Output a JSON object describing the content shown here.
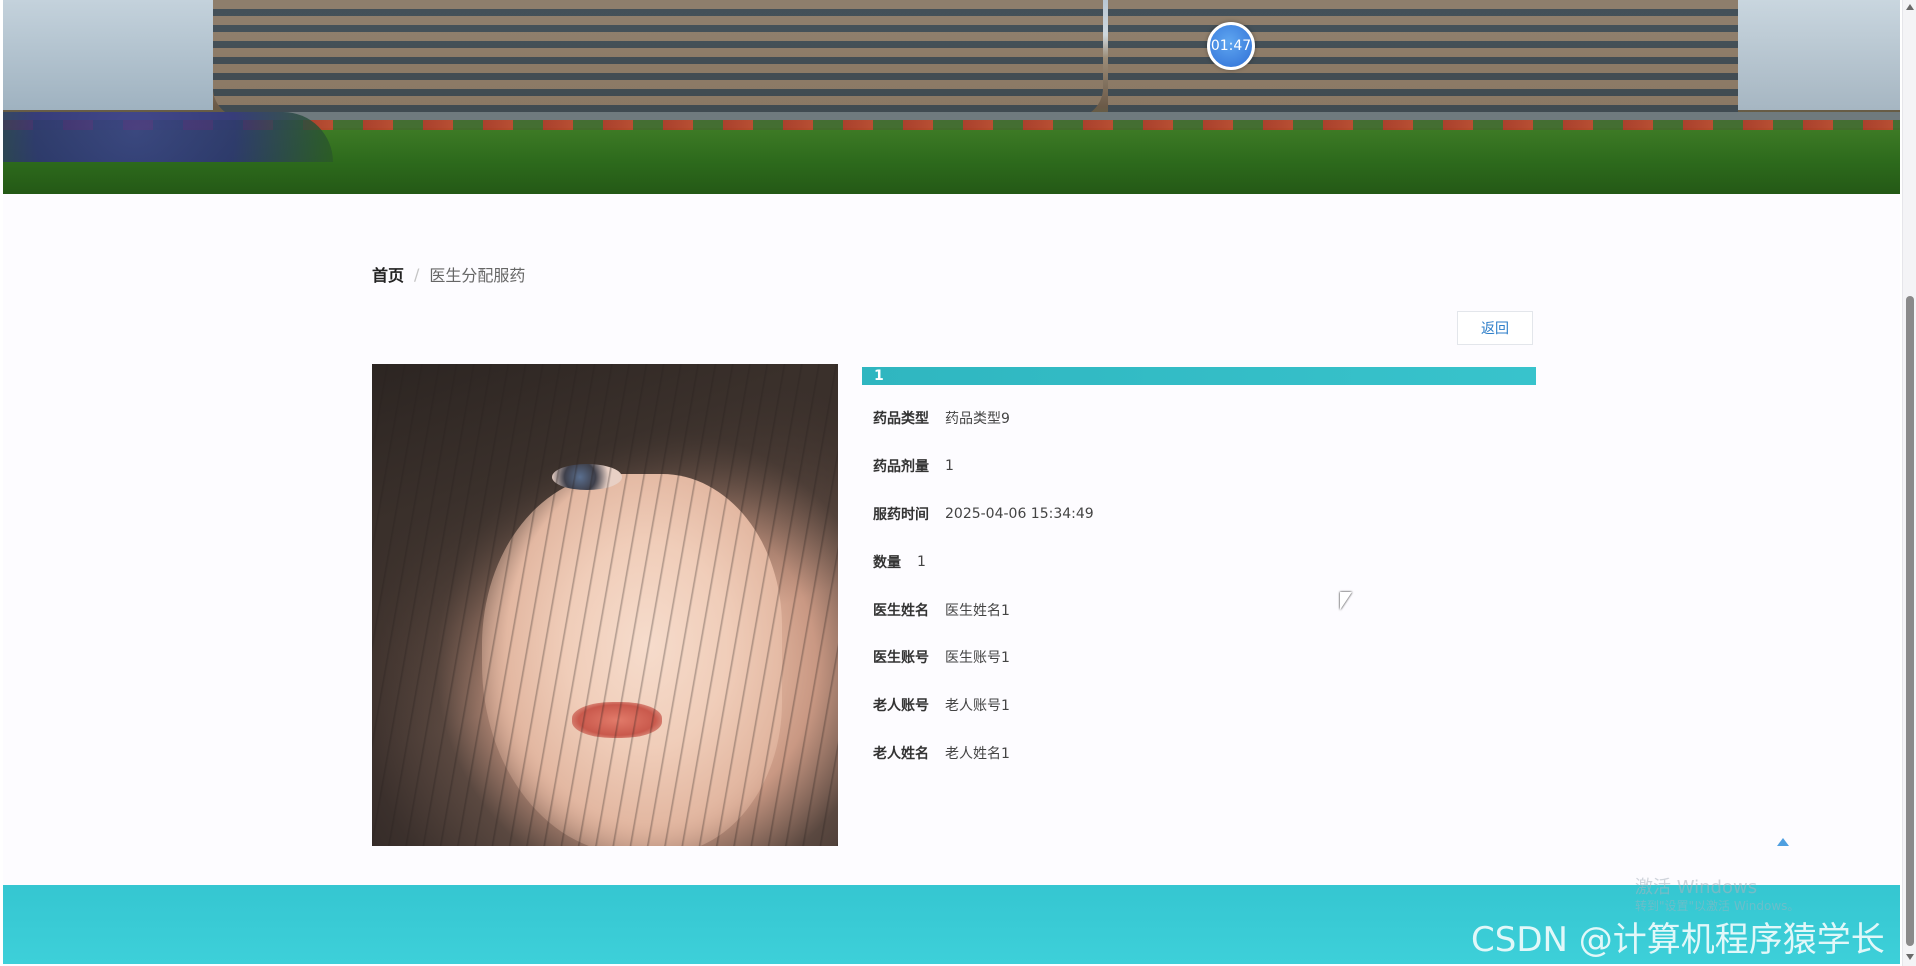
{
  "timer": {
    "text": "01:47"
  },
  "breadcrumb": {
    "home": "首页",
    "separator": "/",
    "current": "医生分配服药"
  },
  "actions": {
    "back_label": "返回"
  },
  "detail": {
    "title": "1",
    "fields": [
      {
        "label": "药品类型",
        "value": "药品类型9"
      },
      {
        "label": "药品剂量",
        "value": "1"
      },
      {
        "label": "服药时间",
        "value": "2025-04-06 15:34:49"
      },
      {
        "label": "数量",
        "value": "1"
      },
      {
        "label": "医生姓名",
        "value": "医生姓名1"
      },
      {
        "label": "医生账号",
        "value": "医生账号1"
      },
      {
        "label": "老人账号",
        "value": "老人账号1"
      },
      {
        "label": "老人姓名",
        "value": "老人姓名1"
      }
    ]
  },
  "watermarks": {
    "windows_line1": "激活 Windows",
    "windows_line2": "转到\"设置\"以激活 Windows。",
    "csdn": "CSDN @计算机程序猿学长"
  },
  "colors": {
    "accent": "#35c6d1",
    "link": "#2d7ec9",
    "timer": "#2f6fd6"
  }
}
